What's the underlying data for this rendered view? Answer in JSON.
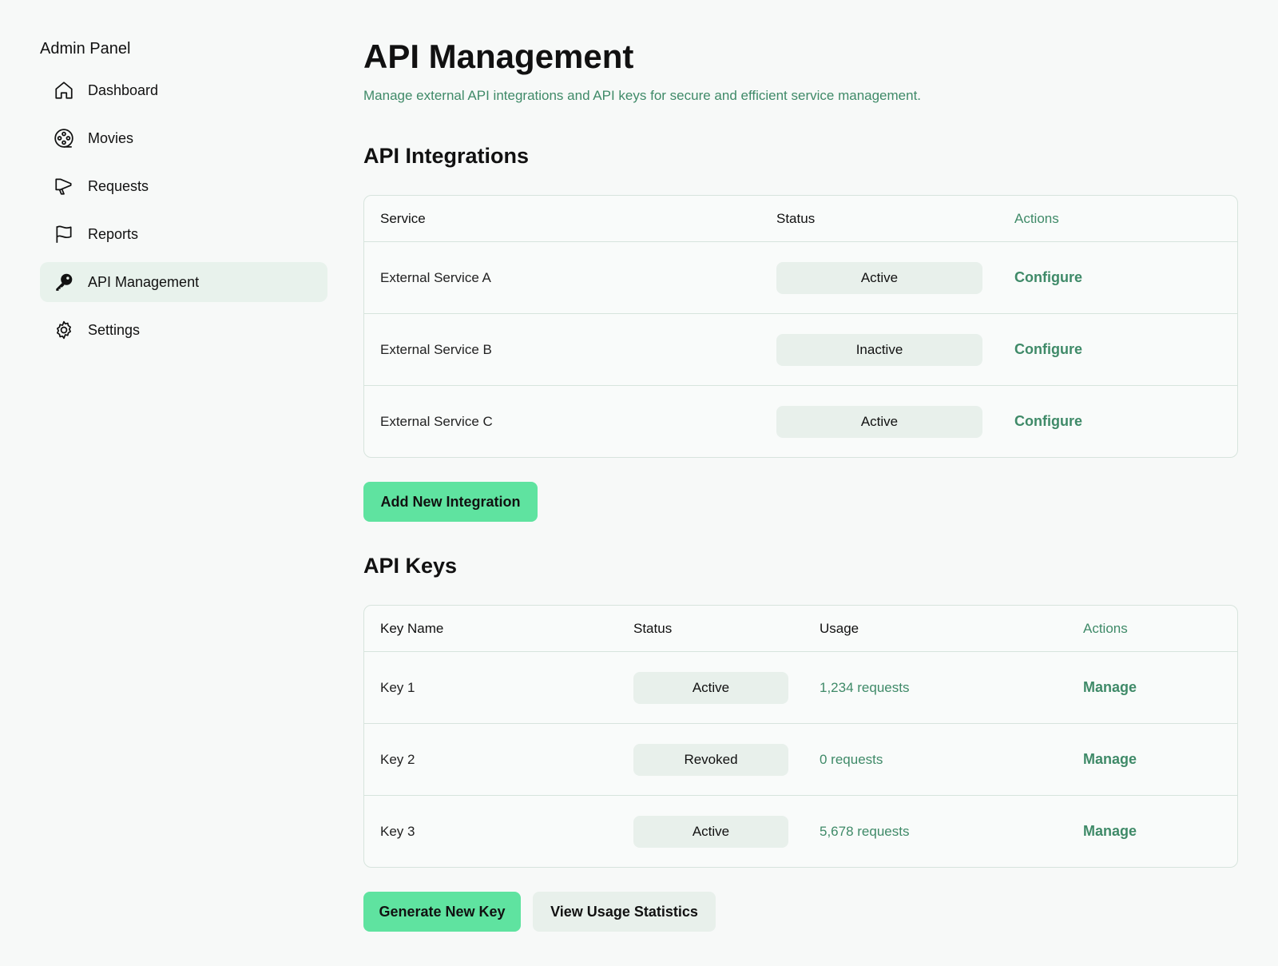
{
  "sidebar": {
    "title": "Admin Panel",
    "items": [
      {
        "label": "Dashboard",
        "icon": "home-icon",
        "active": false
      },
      {
        "label": "Movies",
        "icon": "film-reel-icon",
        "active": false
      },
      {
        "label": "Requests",
        "icon": "megaphone-icon",
        "active": false
      },
      {
        "label": "Reports",
        "icon": "flag-icon",
        "active": false
      },
      {
        "label": "API Management",
        "icon": "key-icon",
        "active": true
      },
      {
        "label": "Settings",
        "icon": "gear-icon",
        "active": false
      }
    ]
  },
  "page": {
    "title": "API Management",
    "subtitle": "Manage external API integrations and API keys for secure and efficient service management."
  },
  "integrations": {
    "title": "API Integrations",
    "headers": {
      "service": "Service",
      "status": "Status",
      "actions": "Actions"
    },
    "rows": [
      {
        "service": "External Service A",
        "status": "Active",
        "action": "Configure"
      },
      {
        "service": "External Service B",
        "status": "Inactive",
        "action": "Configure"
      },
      {
        "service": "External Service C",
        "status": "Active",
        "action": "Configure"
      }
    ],
    "add_button": "Add New Integration"
  },
  "keys": {
    "title": "API Keys",
    "headers": {
      "name": "Key Name",
      "status": "Status",
      "usage": "Usage",
      "actions": "Actions"
    },
    "rows": [
      {
        "name": "Key 1",
        "status": "Active",
        "usage": "1,234 requests",
        "action": "Manage"
      },
      {
        "name": "Key 2",
        "status": "Revoked",
        "usage": "0 requests",
        "action": "Manage"
      },
      {
        "name": "Key 3",
        "status": "Active",
        "usage": "5,678 requests",
        "action": "Manage"
      }
    ],
    "generate_button": "Generate New Key",
    "stats_button": "View Usage Statistics"
  },
  "colors": {
    "accent": "#3f8a68",
    "primary_button": "#5fe3a0",
    "badge_bg": "#e8f0eb",
    "active_nav_bg": "#e8f2ec"
  }
}
